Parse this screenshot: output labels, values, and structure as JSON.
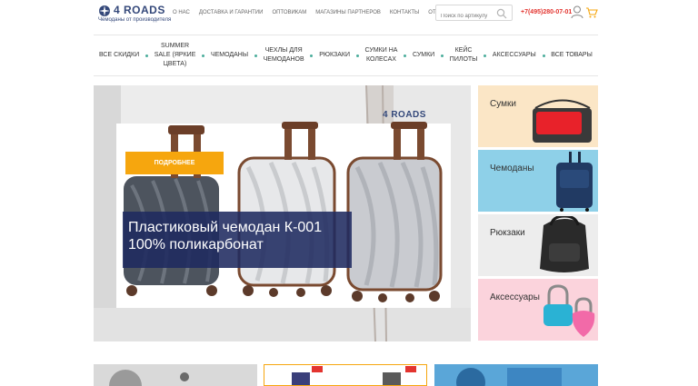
{
  "header": {
    "logo_brand": "4 ROADS",
    "logo_tagline": "Чемоданы от производителя",
    "nav": [
      "О нас",
      "Доставка и гарантии",
      "Оптовикам",
      "Магазины партнеров",
      "Контакты",
      "Отзывы"
    ],
    "search_placeholder": "Поиск по артикулу",
    "phone": "+7(495)280-07-01"
  },
  "categories": [
    {
      "line1": "Все скидки",
      "line2": ""
    },
    {
      "line1": "Summer",
      "line2": "Sale (яркие",
      "line3": "цвета)"
    },
    {
      "line1": "Чемоданы",
      "line2": ""
    },
    {
      "line1": "Чехлы для",
      "line2": "чемоданов"
    },
    {
      "line1": "Рюкзаки",
      "line2": ""
    },
    {
      "line1": "Сумки на",
      "line2": "колесах"
    },
    {
      "line1": "Сумки",
      "line2": ""
    },
    {
      "line1": "Кейс",
      "line2": "пилоты"
    },
    {
      "line1": "Аксессуары",
      "line2": ""
    },
    {
      "line1": "Все товары",
      "line2": ""
    }
  ],
  "hero": {
    "logo": "4 ROADS",
    "button_label": "Подробнее",
    "title_line1": "Пластиковый чемодан К-001",
    "title_line2": "100% поликарбонат"
  },
  "tiles": [
    {
      "label": "Сумки",
      "bg": "#fbe6c6"
    },
    {
      "label": "Чемоданы",
      "bg": "#8ed0e8"
    },
    {
      "label": "Рюкзаки",
      "bg": "#ededed"
    },
    {
      "label": "Аксессуары",
      "bg": "#fbd3dc"
    }
  ],
  "colors": {
    "accent": "#f6a60e",
    "brand": "#34487a",
    "phone": "#e3342f",
    "caption_bg": "#1f2a60"
  }
}
